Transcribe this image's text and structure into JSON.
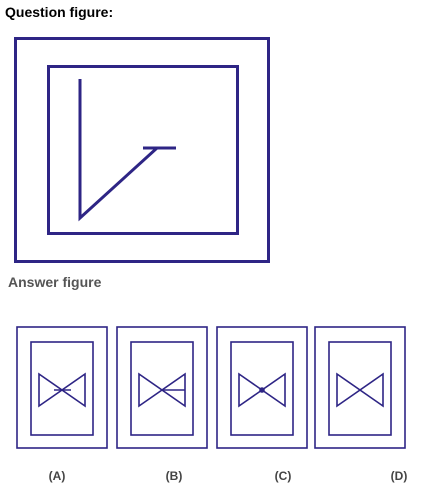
{
  "question": {
    "label": "Question figure:"
  },
  "answer": {
    "label": "Answer figure",
    "options": [
      {
        "label": "(A)",
        "variant": "bowtie-one-line"
      },
      {
        "label": "(B)",
        "variant": "bowtie-line-right"
      },
      {
        "label": "(C)",
        "variant": "bowtie-dot-center"
      },
      {
        "label": "(D)",
        "variant": "bowtie-plain"
      }
    ]
  },
  "colors": {
    "line": "#2e2585",
    "text_primary": "#000000",
    "text_secondary": "#555555"
  }
}
